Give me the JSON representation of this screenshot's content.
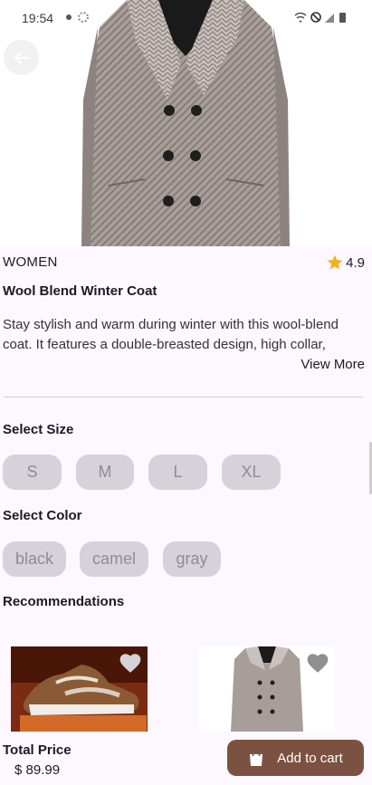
{
  "status_bar": {
    "time": "19:54"
  },
  "product": {
    "category": "WOMEN",
    "rating": "4.9",
    "title": "Wool Blend Winter Coat",
    "description": "Stay stylish and warm during winter with this wool-blend coat. It features a double-breasted design, high collar,",
    "view_more": "View More"
  },
  "size": {
    "label": "Select Size",
    "options": [
      "S",
      "M",
      "L",
      "XL"
    ]
  },
  "color": {
    "label": "Select Color",
    "options": [
      "black",
      "camel",
      "gray"
    ]
  },
  "recommendations": {
    "label": "Recommendations"
  },
  "footer": {
    "total_label": "Total Price",
    "total_value": "$ 89.99",
    "cart_button": "Add to cart"
  },
  "colors": {
    "accent_brown": "#7b5241",
    "background": "#fdf7ff",
    "star": "#f2b01e",
    "chip": "#d5d3d9"
  }
}
